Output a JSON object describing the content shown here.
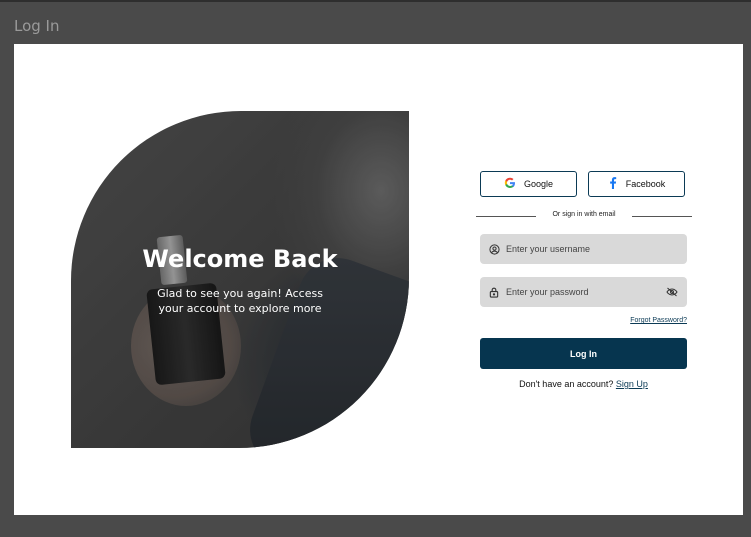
{
  "window": {
    "title": "Log In"
  },
  "hero": {
    "title": "Welcome Back",
    "subtitle": "Glad to see you again! Access your account to explore more"
  },
  "social": {
    "google_label": "Google",
    "facebook_label": "Facebook"
  },
  "divider": {
    "text": "Or sign in with email"
  },
  "form": {
    "username_placeholder": "Enter your username",
    "password_placeholder": "Enter your password",
    "forgot_label": "Forgot Password?",
    "login_label": "Log In",
    "signup_prompt": "Don't have an account?",
    "signup_link": "Sign Up"
  },
  "icons": {
    "username": "user-circle-icon",
    "password": "lock-icon",
    "visibility": "eye-off-icon",
    "google": "google-icon",
    "facebook": "facebook-icon"
  },
  "colors": {
    "primary": "#06354f",
    "field_bg": "#d9d9d9",
    "backdrop": "#4a4a4a"
  }
}
